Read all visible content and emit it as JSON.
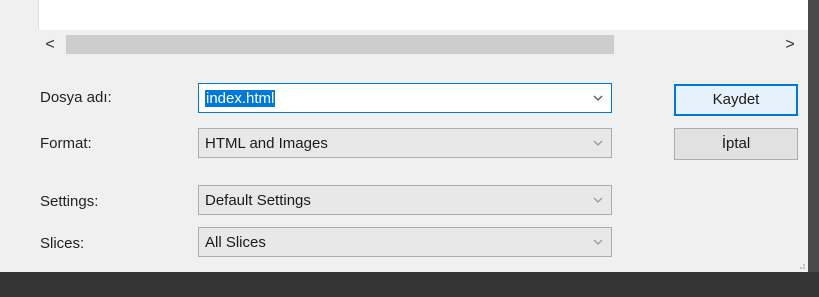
{
  "scrollbar": {
    "left_arrow": "<",
    "right_arrow": ">"
  },
  "form": {
    "filename_label": "Dosya adı:",
    "filename_value": "index.html",
    "format_label": "Format:",
    "format_value": "HTML and Images",
    "settings_label": "Settings:",
    "settings_value": "Default Settings",
    "slices_label": "Slices:",
    "slices_value": "All Slices"
  },
  "buttons": {
    "save": "Kaydet",
    "cancel": "İptal"
  },
  "colors": {
    "selection": "#0078d7",
    "dialog_bg": "#f0f0f0"
  }
}
